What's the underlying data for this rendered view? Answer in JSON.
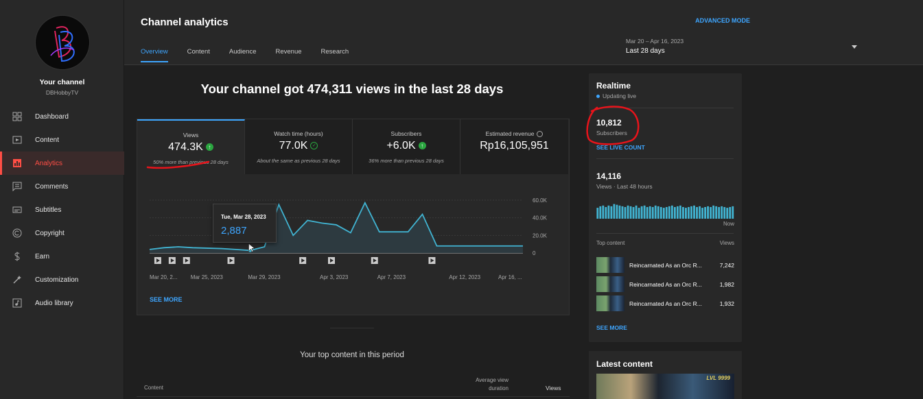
{
  "sidebar": {
    "channel_title": "Your channel",
    "channel_handle": "DBHobbyTV",
    "items": [
      {
        "label": "Dashboard",
        "icon": "dashboard-icon"
      },
      {
        "label": "Content",
        "icon": "content-icon"
      },
      {
        "label": "Analytics",
        "icon": "analytics-icon",
        "active": true
      },
      {
        "label": "Comments",
        "icon": "comments-icon"
      },
      {
        "label": "Subtitles",
        "icon": "subtitles-icon"
      },
      {
        "label": "Copyright",
        "icon": "copyright-icon"
      },
      {
        "label": "Earn",
        "icon": "earn-icon"
      },
      {
        "label": "Customization",
        "icon": "customization-icon"
      },
      {
        "label": "Audio library",
        "icon": "audio-library-icon"
      }
    ]
  },
  "header": {
    "title": "Channel analytics",
    "advanced_mode": "ADVANCED MODE",
    "tabs": [
      {
        "label": "Overview",
        "active": true
      },
      {
        "label": "Content"
      },
      {
        "label": "Audience"
      },
      {
        "label": "Revenue"
      },
      {
        "label": "Research"
      }
    ],
    "range_dates": "Mar 20 – Apr 16, 2023",
    "range_label": "Last 28 days"
  },
  "main": {
    "headline": "Your channel got 474,311 views in the last 28 days",
    "metrics": [
      {
        "label": "Views",
        "value": "474.3K",
        "note": "50% more than previous 28 days",
        "badge": "up"
      },
      {
        "label": "Watch time (hours)",
        "value": "77.0K",
        "note": "About the same as previous 28 days",
        "badge": "check"
      },
      {
        "label": "Subscribers",
        "value": "+6.0K",
        "note": "36% more than previous 28 days",
        "badge": "up"
      },
      {
        "label": "Estimated revenue",
        "value": "Rp16,105,951",
        "note": "",
        "badge": "info"
      }
    ],
    "tooltip": {
      "date": "Tue, Mar 28, 2023",
      "value": "2,887"
    },
    "see_more": "SEE MORE",
    "top_content_title": "Your top content in this period",
    "top_content_columns": {
      "content": "Content",
      "avg_duration": "Average view duration",
      "views": "Views"
    }
  },
  "chart_data": {
    "type": "area",
    "series": [
      {
        "values": [
          4000,
          6000,
          7000,
          6000,
          5500,
          5000,
          4000,
          2887,
          7000,
          55000,
          20000,
          37000,
          34000,
          32000,
          23000,
          57000,
          24000,
          24000,
          24000,
          44000,
          8000,
          8000,
          8000,
          8000,
          8000,
          8000,
          8000
        ]
      }
    ],
    "x_tick_labels": [
      "Mar 20, 2...",
      "Mar 25, 2023",
      "Mar 29, 2023",
      "Apr 3, 2023",
      "Apr 7, 2023",
      "Apr 12, 2023",
      "Apr 16, ..."
    ],
    "y_tick_labels": [
      "60.0K",
      "40.0K",
      "20.0K",
      "0"
    ],
    "ylim": [
      0,
      60000
    ],
    "grid": true,
    "color": "#41b4d2"
  },
  "realtime": {
    "title": "Realtime",
    "status": "Updating live",
    "subscribers": "10,812",
    "subscribers_label": "Subscribers",
    "see_live_count": "SEE LIVE COUNT",
    "views": "14,116",
    "views_label": "Views · Last 48 hours",
    "now_label": "Now",
    "bars": [
      0.45,
      0.55,
      0.6,
      0.5,
      0.6,
      0.55,
      0.7,
      0.65,
      0.6,
      0.55,
      0.5,
      0.6,
      0.55,
      0.5,
      0.6,
      0.45,
      0.55,
      0.6,
      0.5,
      0.55,
      0.5,
      0.6,
      0.55,
      0.5,
      0.45,
      0.5,
      0.55,
      0.6,
      0.5,
      0.55,
      0.6,
      0.5,
      0.45,
      0.5,
      0.55,
      0.6,
      0.5,
      0.55,
      0.45,
      0.5,
      0.55,
      0.5,
      0.6,
      0.55,
      0.5,
      0.55,
      0.5,
      0.45,
      0.5,
      0.55
    ],
    "top_content_label": "Top content",
    "top_views_label": "Views",
    "top_content": [
      {
        "title": "Reincarnated As an Orc R...",
        "views": "7,242"
      },
      {
        "title": "Reincarnated As an Orc R...",
        "views": "1,982"
      },
      {
        "title": "Reincarnated As an Orc R...",
        "views": "1,932"
      }
    ],
    "see_more": "SEE MORE"
  },
  "latest": {
    "title": "Latest content",
    "thumb_text": "LVL 9999"
  },
  "colors": {
    "accent": "#3ea6ff",
    "active_nav": "#ff4e45",
    "positive": "#2ba640",
    "annotation": "#e8141b"
  }
}
